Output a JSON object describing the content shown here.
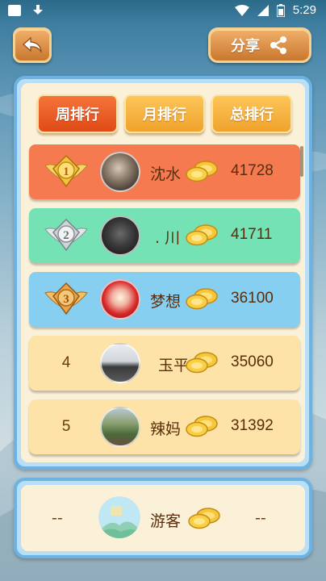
{
  "status_bar": {
    "time": "5:29"
  },
  "header": {
    "share_label": "分享"
  },
  "tabs": [
    {
      "label": "周排行",
      "active": true
    },
    {
      "label": "月排行",
      "active": false
    },
    {
      "label": "总排行",
      "active": false
    }
  ],
  "rows": [
    {
      "rank": "1",
      "name": "沈水",
      "score": "41728",
      "bg": "#f57a50",
      "badge": "gold-medal-icon"
    },
    {
      "rank": "2",
      "name": "​ . 川",
      "score": "41711",
      "bg": "#74e2b4",
      "badge": "silver-medal-icon"
    },
    {
      "rank": "3",
      "name": "梦想",
      "score": "36100",
      "bg": "#86cff0",
      "badge": "bronze-medal-icon"
    },
    {
      "rank": "4",
      "name": "玉平",
      "score": "35060",
      "bg": "#fde3a8"
    },
    {
      "rank": "5",
      "name": "辣妈",
      "score": "31392",
      "bg": "#fde3a8"
    }
  ],
  "self": {
    "rank": "--",
    "name": "游客",
    "score": "--"
  },
  "colors": {
    "accent_tab": "#e8562a",
    "idle_tab": "#f6ae3a",
    "panel_border": "#6cb3e4"
  }
}
